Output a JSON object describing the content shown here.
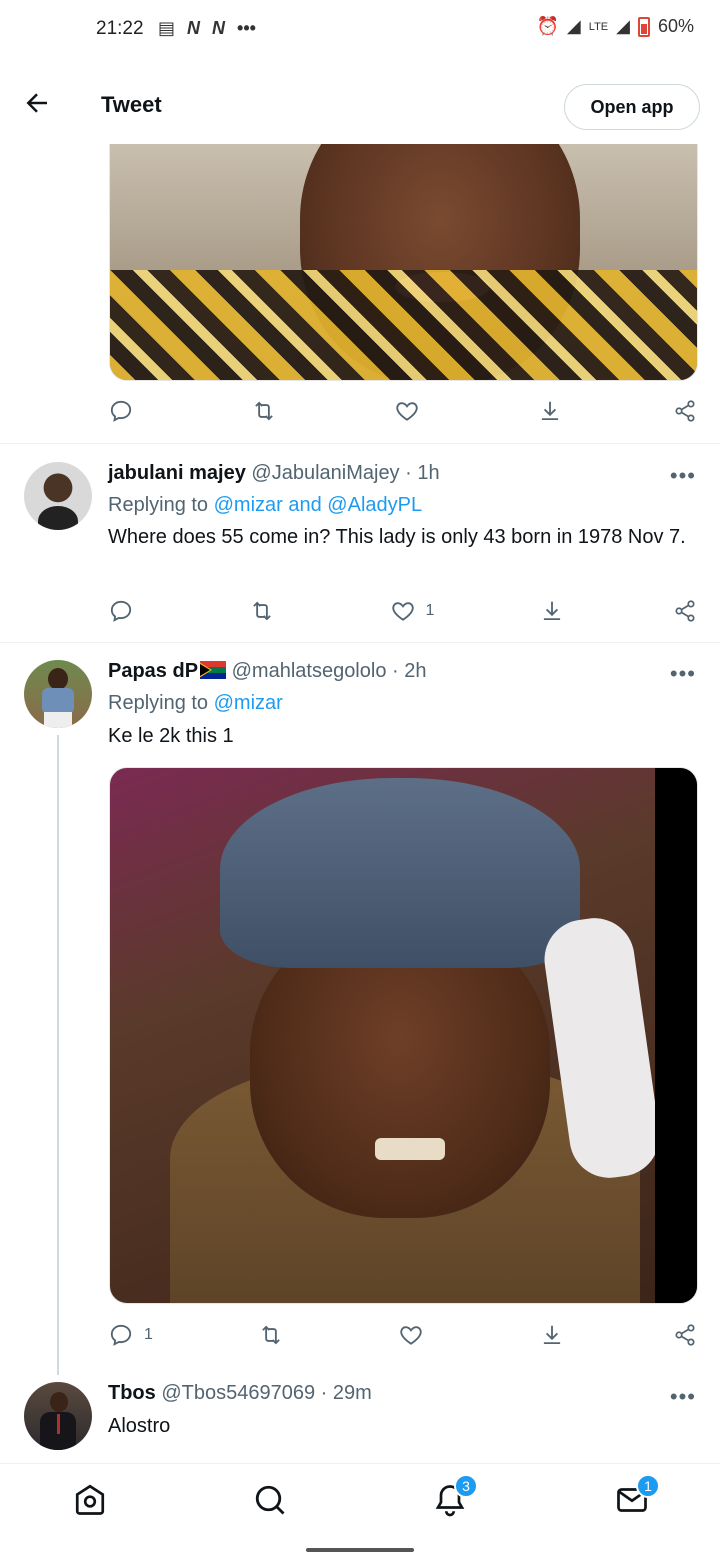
{
  "status_bar": {
    "time": "21:22",
    "left_icons": [
      "messages-icon",
      "netflix-icon",
      "netflix-icon",
      "more-dots-icon"
    ],
    "network": "LTE",
    "battery": "60%"
  },
  "header": {
    "title": "Tweet",
    "open_app_label": "Open app"
  },
  "first_tweet_actions": {
    "reply_count": "",
    "retweet_count": "",
    "like_count": ""
  },
  "replies": [
    {
      "name": "jabulani majey",
      "handle": "@JabulaniMajey",
      "time": "· 1h",
      "replying_prefix": "Replying to ",
      "replying_to": "@mizar and @AladyPL",
      "text": "Where does 55 come in? This lady is only 43 born in 1978 Nov 7.",
      "reply_count": "",
      "retweet_count": "",
      "like_count": "1"
    },
    {
      "name": "Papas dP",
      "handle": "@mahlatsegololo",
      "time": "· 2h",
      "replying_prefix": "Replying to ",
      "replying_to": "@mizar",
      "text": "Ke le 2k this 1",
      "reply_count": "1",
      "retweet_count": "",
      "like_count": ""
    },
    {
      "name": "Tbos",
      "handle": "@Tbos54697069",
      "time": "· 29m",
      "text": "Alostro"
    }
  ],
  "bottom_nav": {
    "notifications_badge": "3",
    "messages_badge": "1"
  },
  "colors": {
    "accent": "#1d9bf0",
    "text_primary": "#0f1419",
    "text_secondary": "#536471"
  }
}
